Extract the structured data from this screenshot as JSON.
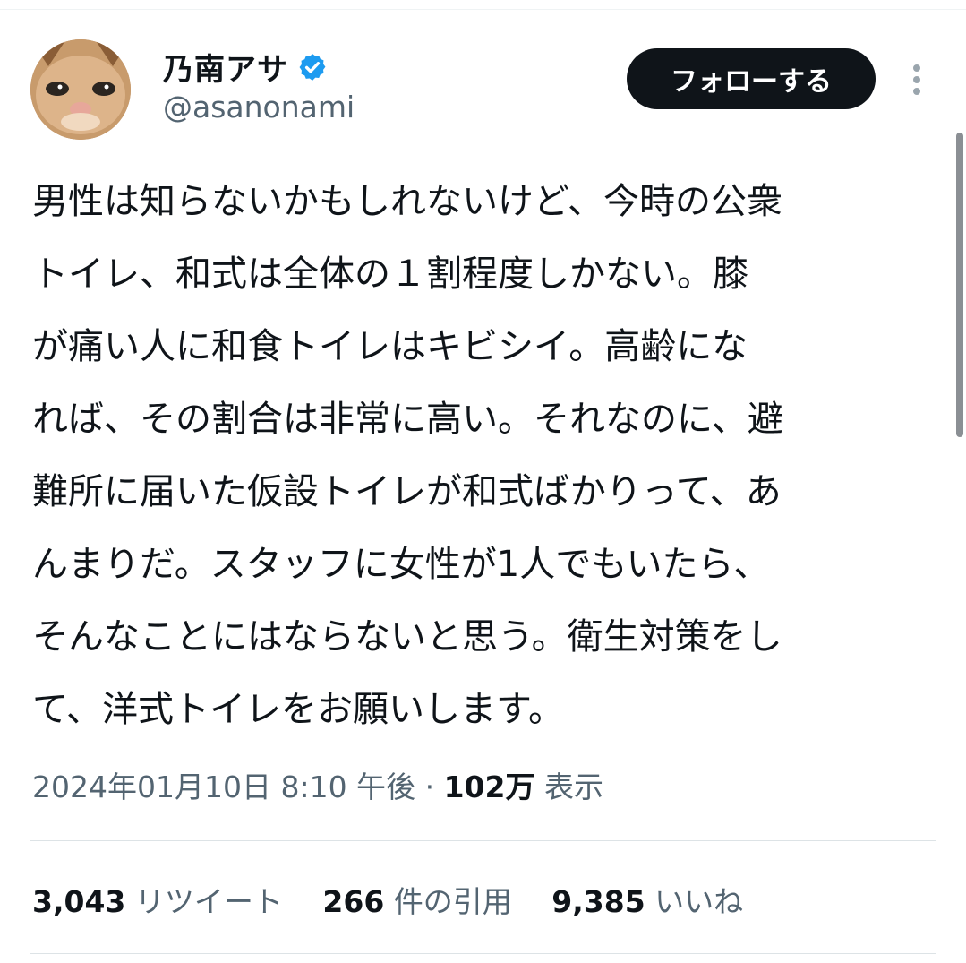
{
  "author": {
    "display_name": "乃南アサ",
    "handle": "@asanonami",
    "verified": true,
    "verified_color": "#1d9bf0"
  },
  "follow_button": {
    "label": "フォローする"
  },
  "more_button": {
    "icon": "more-vertical-icon"
  },
  "tweet": {
    "lines": [
      "男性は知らないかもしれないけど、今時の公衆",
      "トイレ、和式は全体の１割程度しかない。膝",
      "が痛い人に和食トイレはキビシイ。高齢にな",
      "れば、その割合は非常に高い。それなのに、避",
      "難所に届いた仮設トイレが和式ばかりって、あ",
      "んまりだ。スタッフに女性が1人でもいたら、",
      "そんなことにはならないと思う。衛生対策をし",
      "て、洋式トイレをお願いします。"
    ]
  },
  "meta": {
    "timestamp": "2024年01月10日 8:10 午後",
    "separator": "·",
    "views_count": "102万",
    "views_label": "表示"
  },
  "stats": {
    "retweets_count": "3,043",
    "retweets_label": "リツイート",
    "quotes_count": "266",
    "quotes_label": "件の引用",
    "likes_count": "9,385",
    "likes_label": "いいね"
  },
  "colors": {
    "text": "#0f1419",
    "secondary": "#536471",
    "button_bg": "#0f1419"
  }
}
